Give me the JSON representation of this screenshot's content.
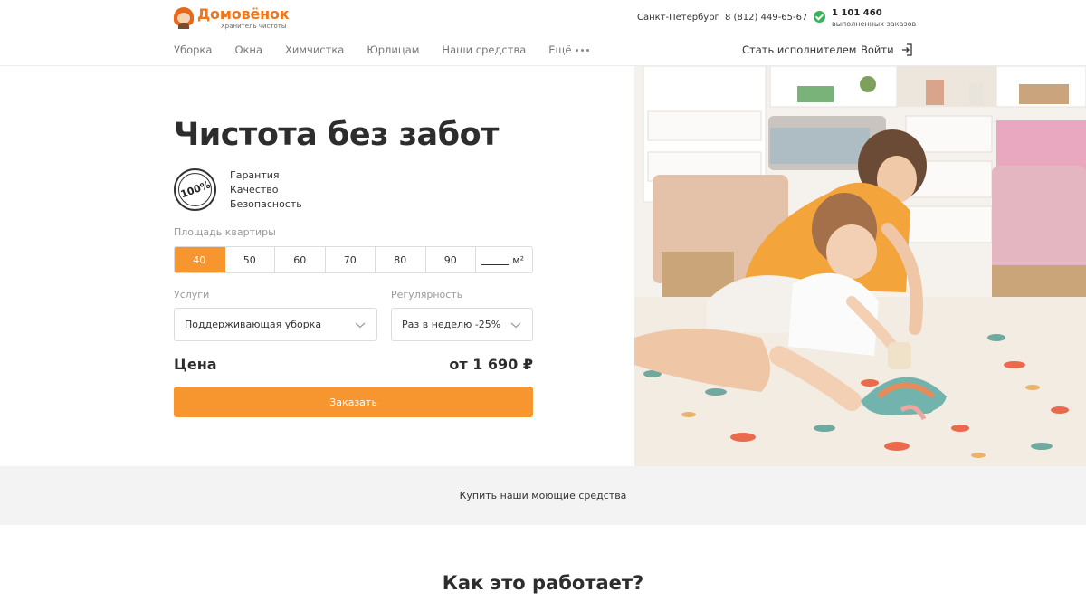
{
  "brand": {
    "name": "Домовёнок",
    "tagline": "Хранитель чистоты",
    "accent": "#f7962e",
    "logo_color": "#f0761a"
  },
  "topbar": {
    "city": "Санкт-Петербург",
    "phone": "8 (812) 449-65-67",
    "orders_count": "1 101 460",
    "orders_label": "выполненных заказов"
  },
  "nav": {
    "items": [
      "Уборка",
      "Окна",
      "Химчистка",
      "Юрлицам",
      "Наши средства"
    ],
    "more": "Ещё",
    "become_performer": "Стать исполнителем",
    "login": "Войти"
  },
  "hero": {
    "title": "Чистота без забот",
    "badge": "100%",
    "features": [
      "Гарантия",
      "Качество",
      "Безопасность"
    ],
    "area_label": "Площадь квартиры",
    "area_options": [
      "40",
      "50",
      "60",
      "70",
      "80",
      "90"
    ],
    "area_selected": "40",
    "area_unit": "м²",
    "services_label": "Услуги",
    "services_value": "Поддерживающая уборка",
    "regularity_label": "Регулярность",
    "regularity_value": "Раз в неделю -25%",
    "price_label": "Цена",
    "price_value": "от 1 690 ₽",
    "order_button": "Заказать"
  },
  "buy_band": "Купить наши моющие средства",
  "how_title": "Как это работает?"
}
